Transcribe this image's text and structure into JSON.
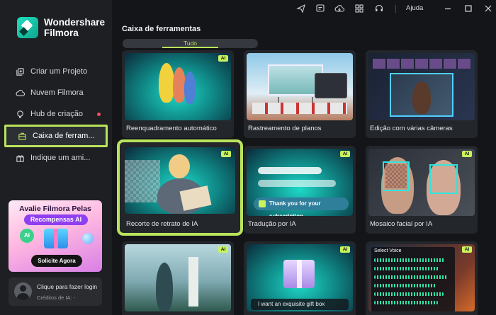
{
  "app": {
    "logo_line1": "Wondershare",
    "logo_line2": "Filmora"
  },
  "titlebar": {
    "help_label": "Ajuda",
    "icons": [
      "send-icon",
      "chat-icon",
      "cloud-icon",
      "grid-icon",
      "headset-icon",
      "minimize-icon",
      "maximize-icon",
      "close-icon"
    ]
  },
  "sidebar": {
    "items": [
      {
        "label": "Criar um Projeto",
        "icon": "add-circle-icon"
      },
      {
        "label": "Nuvem Filmora",
        "icon": "cloud-icon"
      },
      {
        "label": "Hub de criação",
        "icon": "bulb-icon"
      },
      {
        "label": "Caixa de ferram...",
        "icon": "toolbox-icon"
      },
      {
        "label": "Indique um ami...",
        "icon": "gift-icon"
      }
    ],
    "promo": {
      "title": "Avalie Filmora Pelas",
      "pill": "Recompensas AI",
      "ai_label": "AI",
      "button": "Solicite Agora"
    },
    "login": {
      "label": "Clique para fazer login",
      "credits": "Créditos de IA: -"
    }
  },
  "main": {
    "title": "Caixa de ferramentas",
    "filter_tab": "Tudo",
    "ai_badge": "AI",
    "cards": [
      {
        "label": "Reenquadramento automático"
      },
      {
        "label": "Rastreamento de planos"
      },
      {
        "label": "Edição com várias câmeras"
      },
      {
        "label": "Recorte de retrato de IA"
      },
      {
        "label": "Tradução por IA",
        "subtitle_chip": "Thank you for your subscription"
      },
      {
        "label": "Mosaico facial por IA"
      },
      {
        "label": ""
      },
      {
        "label": "",
        "prompt": "I want an exquisite gift box"
      },
      {
        "label": "",
        "voice_title": "Select Voice"
      }
    ]
  },
  "colors": {
    "accent": "#b9e35b",
    "sidebar_bg": "#1d1f23",
    "page_bg": "#141518",
    "notification_dot": "#ff4c5b"
  }
}
